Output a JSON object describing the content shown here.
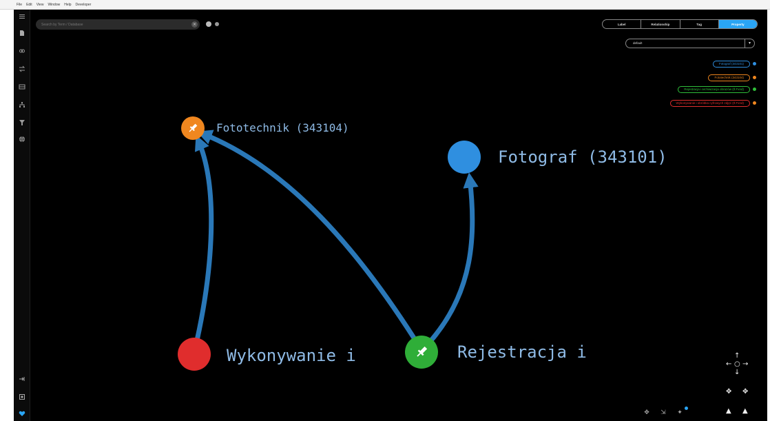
{
  "menubar": {
    "items": [
      "File",
      "Edit",
      "View",
      "Window",
      "Help",
      "Developer"
    ]
  },
  "sidebar": {
    "top_icons": [
      "menu-icon",
      "file-icon",
      "link-icon",
      "swap-icon",
      "table-icon",
      "hierarchy-icon",
      "filter-icon",
      "globe-icon"
    ],
    "bottom_icons": [
      "export-icon",
      "square-icon",
      "heart-icon"
    ]
  },
  "search": {
    "placeholder": "Search by Term / Database"
  },
  "tabs": {
    "items": [
      "Label",
      "Relationship",
      "Tag",
      "Property"
    ],
    "active": "Property"
  },
  "layout_select": {
    "value": "default"
  },
  "legend": {
    "items": [
      {
        "label": "Fotograf (343101)",
        "color": "#2f8fe0"
      },
      {
        "label": "Fototechnik (343104)",
        "color": "#f0871f"
      },
      {
        "label": "Rejestracja i archiwizacja obrazów (tf.Fxnd)",
        "color": "#2fbf3a"
      },
      {
        "label": "Wykonywanie i obróbka cyfrowych zdjęć (tf.Fxnd)",
        "color": "#e02d2d"
      }
    ]
  },
  "graph": {
    "nodes": {
      "fototechnik": {
        "label": "Fototechnik (343104)",
        "color": "#f0871f"
      },
      "fotograf": {
        "label": "Fotograf (343101)",
        "color": "#2f8fe0"
      },
      "wykonywanie": {
        "label": "Wykonywanie i",
        "color": "#e02d2d"
      },
      "rejestracja": {
        "label": "Rejestracja i",
        "color": "#2fae38"
      }
    },
    "edge_color": "#2a78b8"
  }
}
